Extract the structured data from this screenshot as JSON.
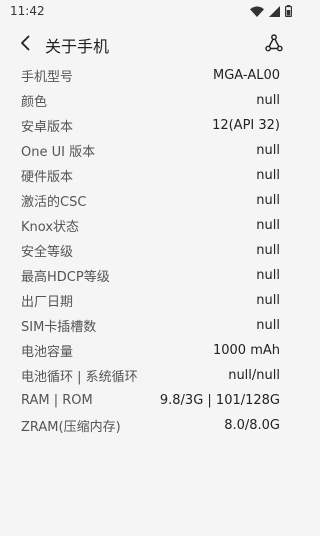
{
  "status_bar": {
    "time": "11:42",
    "icons": [
      "wifi-icon",
      "signal-icon",
      "battery-icon"
    ]
  },
  "header": {
    "back_icon": "back-arrow-icon",
    "title": "关于手机",
    "share_icon": "share-icon"
  },
  "info": {
    "rows": [
      {
        "label": "手机型号",
        "value": "MGA-AL00"
      },
      {
        "label": "颜色",
        "value": "null"
      },
      {
        "label": "安卓版本",
        "value": "12(API 32)"
      },
      {
        "label": "One UI 版本",
        "value": "null"
      },
      {
        "label": "硬件版本",
        "value": "null"
      },
      {
        "label": "激活的CSC",
        "value": "null"
      },
      {
        "label": "Knox状态",
        "value": "null"
      },
      {
        "label": "安全等级",
        "value": "null"
      },
      {
        "label": "最高HDCP等级",
        "value": "null"
      },
      {
        "label": "出厂日期",
        "value": "null"
      },
      {
        "label": "SIM卡插槽数",
        "value": "null"
      },
      {
        "label": "电池容量",
        "value": "1000 mAh"
      },
      {
        "label": "电池循环 | 系统循环",
        "value": "null/null"
      },
      {
        "label": "RAM | ROM",
        "value": "9.8/3G | 101/128G"
      },
      {
        "label": "ZRAM(压缩内存)",
        "value": "8.0/8.0G"
      }
    ]
  },
  "colors": {
    "background": "#f5f5f5",
    "text_primary": "#222222",
    "text_secondary": "#555555"
  }
}
